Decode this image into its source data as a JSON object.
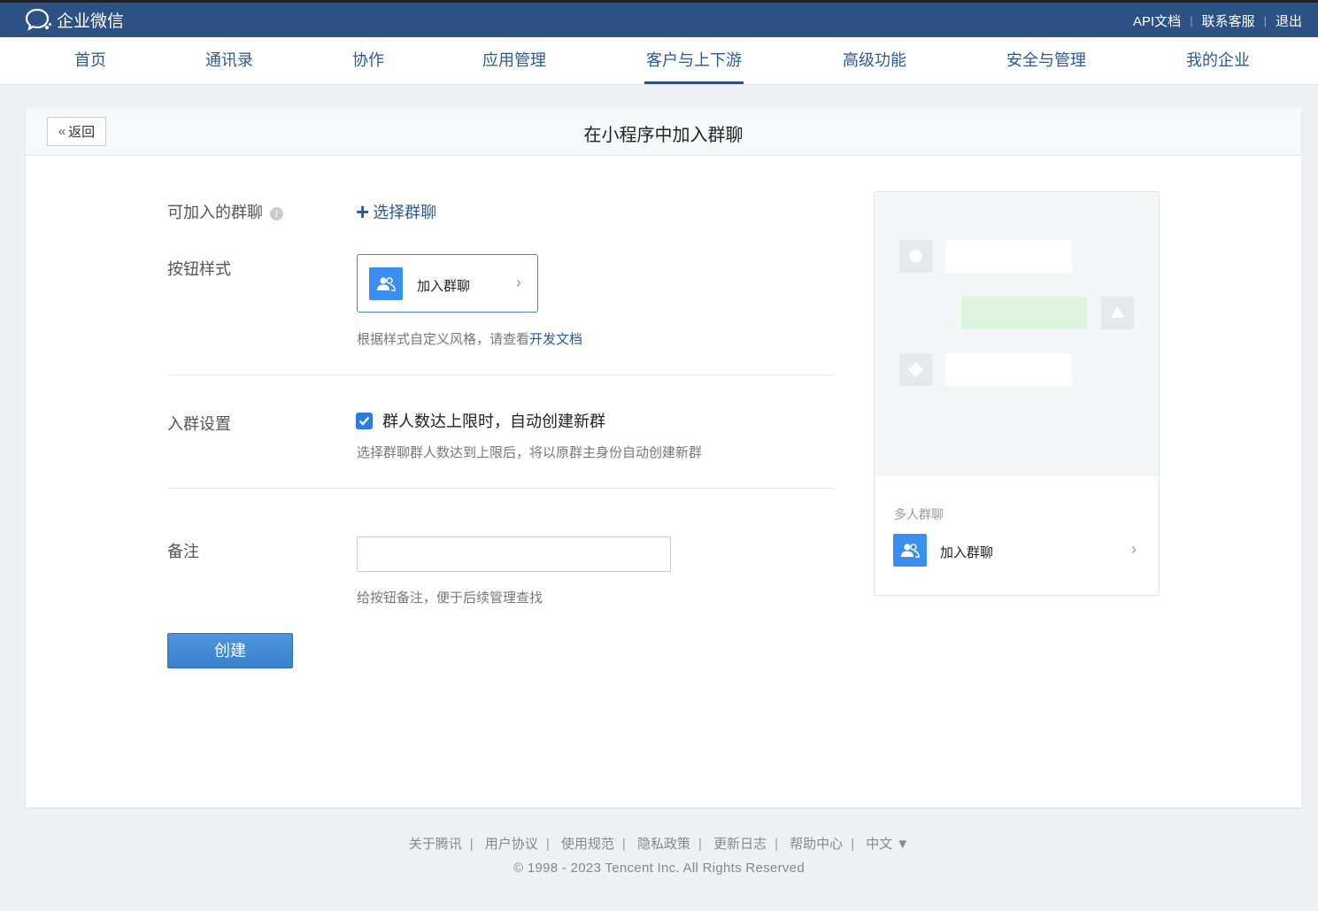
{
  "header": {
    "logo_text": "企业微信",
    "links": [
      "API文档",
      "联系客服",
      "退出"
    ]
  },
  "nav": {
    "items": [
      "首页",
      "通讯录",
      "协作",
      "应用管理",
      "客户与上下游",
      "高级功能",
      "安全与管理",
      "我的企业"
    ],
    "active": "客户与上下游"
  },
  "page": {
    "back_label": "返回",
    "title": "在小程序中加入群聊"
  },
  "form": {
    "joinable_groups_label": "可加入的群聊",
    "select_group_label": "选择群聊",
    "button_style_label": "按钮样式",
    "button_preview_text": "加入群聊",
    "style_hint": "根据样式自定义风格，请查看",
    "dev_doc_link": "开发文档",
    "join_settings_label": "入群设置",
    "auto_create_checked": true,
    "auto_create_label": "群人数达上限时，自动创建新群",
    "auto_create_hint": "选择群聊群人数达到上限后，将以原群主身份自动创建新群",
    "remark_label": "备注",
    "remark_value": "",
    "remark_hint": "给按钮备注，便于后续管理查找",
    "create_button": "创建"
  },
  "preview": {
    "subtitle": "多人群聊",
    "join_text": "加入群聊"
  },
  "footer": {
    "links": [
      "关于腾讯",
      "用户协议",
      "使用规范",
      "隐私政策",
      "更新日志",
      "帮助中心"
    ],
    "language": "中文 ▼",
    "copyright": "© 1998 - 2023 Tencent Inc. All Rights Reserved"
  },
  "colors": {
    "header_bg": "#2c5185",
    "link_blue": "#2c5a92",
    "icon_blue": "#3b8ef0",
    "checkbox_blue": "#2f7ce0"
  }
}
